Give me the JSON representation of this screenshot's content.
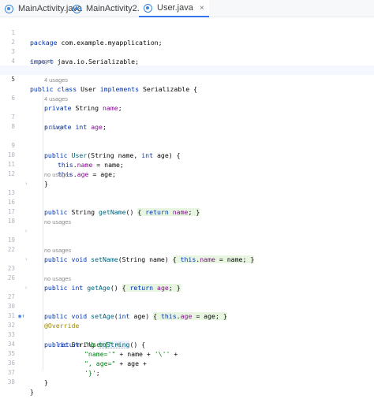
{
  "tabs": [
    {
      "label": "MainActivity.java",
      "active": false
    },
    {
      "label": "MainActivity2.java",
      "active": false
    },
    {
      "label": "User.java",
      "active": true
    }
  ],
  "close_glyph": "×",
  "usages": {
    "u4": "4 usages",
    "u1": "1 usage",
    "none": "no usages"
  },
  "lines": [
    "1",
    "2",
    "3",
    "4",
    "5",
    "6",
    "7",
    "8",
    "9",
    "10",
    "11",
    "12",
    "13",
    "16",
    "17",
    "18",
    "19",
    "22",
    "23",
    "26",
    "27",
    "30",
    "31",
    "32",
    "33",
    "34",
    "35",
    "36",
    "37",
    "38"
  ],
  "code": {
    "package_kw": "package",
    "package_name": " com.example.myapplication;",
    "import_kw": "import",
    "import_name": " java.io.Serializable;",
    "public": "public",
    "private": "private",
    "class": "class",
    "implements": "implements",
    "class_name": " User ",
    "serializable": " Serializable {",
    "string_type": "String",
    "int_type": "int",
    "void_type": "void",
    "return_kw": "return",
    "this_kw": "this",
    "name": "name",
    "age": "age",
    "user_ctor": "User",
    "ctor_params_1": "(String name, ",
    "ctor_params_2": " age) {",
    "assign_name": " = name;",
    "assign_age": " = age;",
    "close_brace": "}",
    "get_name": "getName",
    "set_name": "setName",
    "get_age": "getAge",
    "set_age": "setAge",
    "to_string": "toString",
    "override": "@Override",
    "paren_open": "() ",
    "set_name_params": "(String name) ",
    "set_age_params_1": "(",
    "set_age_params_2": " age) ",
    "open_fold": "{",
    "close_fold": "}",
    "semicolon": ";",
    "ret_str_1": "\"User{\" +",
    "ret_str_2": "\"name='\"",
    "ret_str_2b": " + name + ",
    "ret_str_2c": "'\\''",
    "ret_str_2d": " +",
    "ret_str_3": "\", age=\"",
    "ret_str_3b": " + age +",
    "ret_str_4": "'}'",
    "to_string_tail": "() {"
  }
}
